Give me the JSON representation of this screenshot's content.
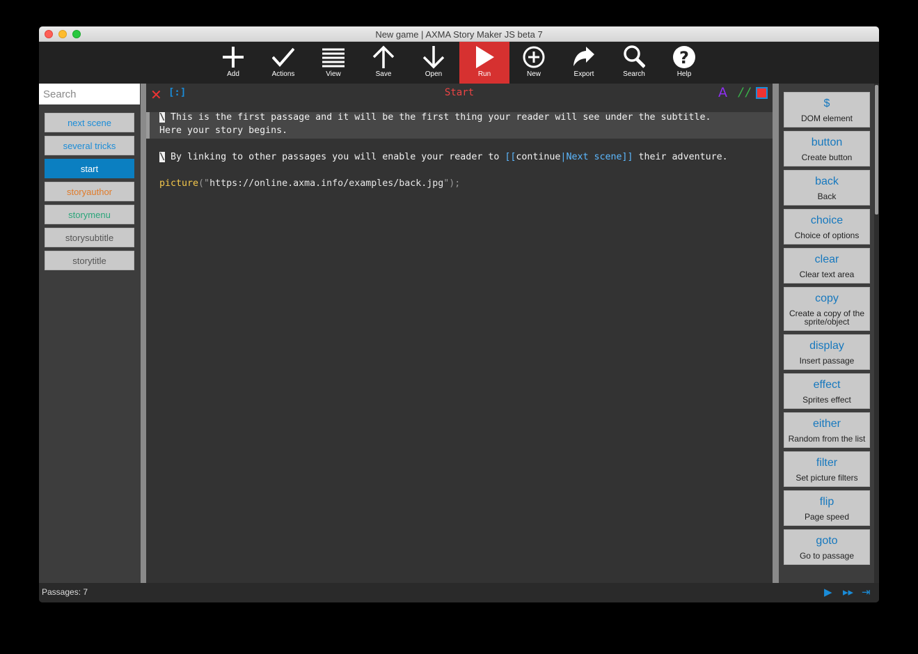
{
  "window": {
    "title": "New game | AXMA Story Maker JS beta 7"
  },
  "toolbar": {
    "items": [
      {
        "label": "Add",
        "icon": "plus-icon"
      },
      {
        "label": "Actions",
        "icon": "check-icon"
      },
      {
        "label": "View",
        "icon": "list-icon"
      },
      {
        "label": "Save",
        "icon": "arrow-up-icon"
      },
      {
        "label": "Open",
        "icon": "arrow-down-icon"
      },
      {
        "label": "Run",
        "icon": "play-icon"
      },
      {
        "label": "New",
        "icon": "circle-plus-icon"
      },
      {
        "label": "Export",
        "icon": "share-arrow-icon"
      },
      {
        "label": "Search",
        "icon": "magnifier-icon"
      },
      {
        "label": "Help",
        "icon": "question-icon"
      }
    ],
    "active_color": "#d63130"
  },
  "sidebar": {
    "search_placeholder": "Search",
    "passages": [
      {
        "name": "next scene",
        "color": "#1a8cd8"
      },
      {
        "name": "several tricks",
        "color": "#1a8cd8"
      },
      {
        "name": "start",
        "color": "#ffffff"
      },
      {
        "name": "storyauthor",
        "color": "#e07b2a"
      },
      {
        "name": "storymenu",
        "color": "#2aa57a"
      },
      {
        "name": "storysubtitle",
        "color": "#555555"
      },
      {
        "name": "storytitle",
        "color": "#555555"
      }
    ]
  },
  "editor": {
    "title": "Start",
    "bracket_btn": "[:]",
    "font_btn": "A",
    "comment_btn": "//",
    "line1a": " This is the first passage and it will be the first thing your reader will see under the subtitle.",
    "line1b": "Here your story begins.",
    "line2_pre": " By linking to other passages you will enable your reader to ",
    "line2_link_open": "[[",
    "line2_link_text": "continue",
    "line2_link_sep": "|",
    "line2_link_target": "Next scene",
    "line2_link_close": "]]",
    "line2_post": " their adventure.",
    "line3_fn": "picture",
    "line3_open": "(\"",
    "line3_str": "https://online.axma.info/examples/back.jpg",
    "line3_close": "\");",
    "marker": "\\"
  },
  "macros": [
    {
      "name": "$",
      "desc": "DOM element"
    },
    {
      "name": "button",
      "desc": "Create button"
    },
    {
      "name": "back",
      "desc": "Back"
    },
    {
      "name": "choice",
      "desc": "Choice of options"
    },
    {
      "name": "clear",
      "desc": "Clear text area"
    },
    {
      "name": "copy",
      "desc": "Create a copy of the sprite/object"
    },
    {
      "name": "display",
      "desc": "Insert passage"
    },
    {
      "name": "effect",
      "desc": "Sprites effect"
    },
    {
      "name": "either",
      "desc": "Random from the list"
    },
    {
      "name": "filter",
      "desc": "Set picture filters"
    },
    {
      "name": "flip",
      "desc": "Page speed"
    },
    {
      "name": "goto",
      "desc": "Go to passage"
    }
  ],
  "status": {
    "passages": "Passages: 7"
  }
}
